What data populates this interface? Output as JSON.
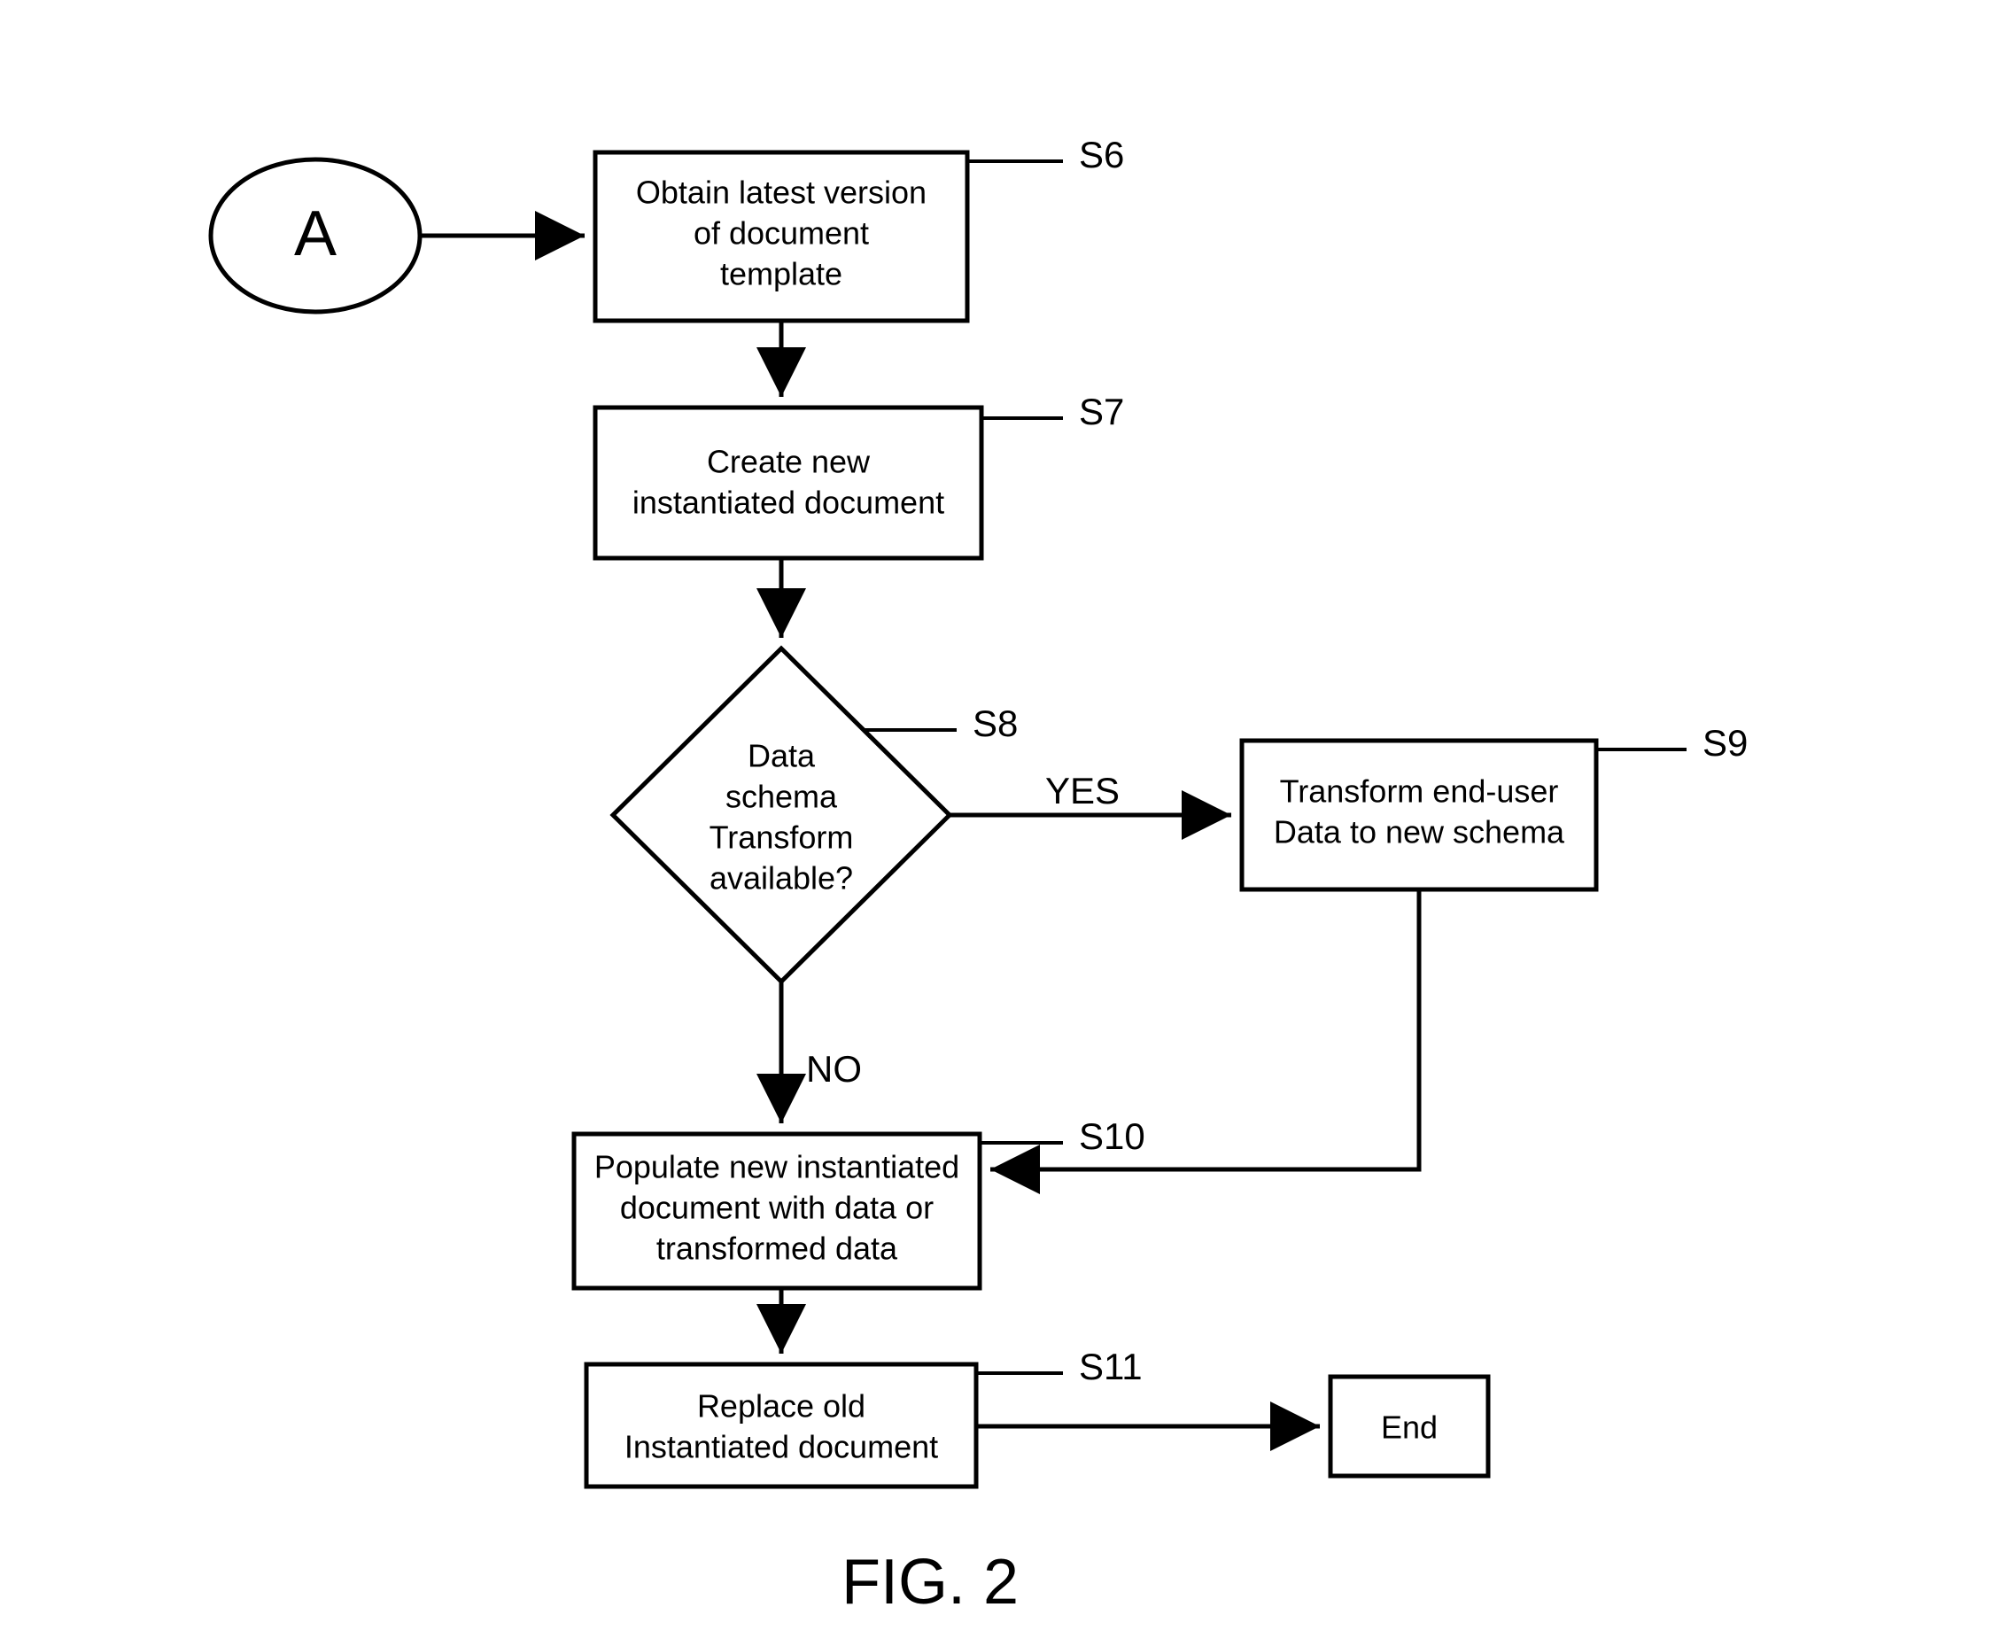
{
  "diagram": {
    "figure_label": "FIG. 2",
    "start": {
      "label": "A"
    },
    "nodes": {
      "s6": {
        "ref": "S6",
        "text": [
          "Obtain latest version",
          "of document",
          "template"
        ]
      },
      "s7": {
        "ref": "S7",
        "text": [
          "Create new",
          "instantiated document"
        ]
      },
      "s8": {
        "ref": "S8",
        "text": [
          "Data",
          "schema",
          "Transform",
          "available?"
        ],
        "yes_label": "YES",
        "no_label": "NO"
      },
      "s9": {
        "ref": "S9",
        "text": [
          "Transform end-user",
          "Data to new schema"
        ]
      },
      "s10": {
        "ref": "S10",
        "text": [
          "Populate new instantiated",
          "document with data or",
          "transformed data"
        ]
      },
      "s11": {
        "ref": "S11",
        "text": [
          "Replace old",
          "Instantiated document"
        ]
      },
      "end": {
        "label": "End"
      }
    }
  },
  "chart_data": {
    "type": "graph",
    "title": "FIG. 2",
    "nodes": [
      {
        "id": "A",
        "label": "A",
        "kind": "connector"
      },
      {
        "id": "S6",
        "label": "Obtain latest version of document template",
        "kind": "process"
      },
      {
        "id": "S7",
        "label": "Create new instantiated document",
        "kind": "process"
      },
      {
        "id": "S8",
        "label": "Data schema Transform available?",
        "kind": "decision"
      },
      {
        "id": "S9",
        "label": "Transform end-user Data to new schema",
        "kind": "process"
      },
      {
        "id": "S10",
        "label": "Populate new instantiated document with data or transformed data",
        "kind": "process"
      },
      {
        "id": "S11",
        "label": "Replace old Instantiated document",
        "kind": "process"
      },
      {
        "id": "END",
        "label": "End",
        "kind": "terminator"
      }
    ],
    "edges": [
      {
        "source": "A",
        "target": "S6"
      },
      {
        "source": "S6",
        "target": "S7"
      },
      {
        "source": "S7",
        "target": "S8"
      },
      {
        "source": "S8",
        "target": "S9",
        "label": "YES"
      },
      {
        "source": "S8",
        "target": "S10",
        "label": "NO"
      },
      {
        "source": "S9",
        "target": "S10"
      },
      {
        "source": "S10",
        "target": "S11"
      },
      {
        "source": "S11",
        "target": "END"
      }
    ]
  }
}
